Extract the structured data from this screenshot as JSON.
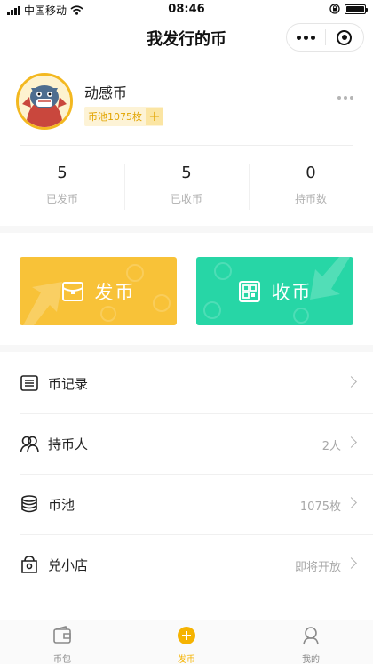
{
  "status_bar": {
    "carrier": "中国移动",
    "time": "08:46",
    "battery_level": 1.0
  },
  "nav": {
    "title": "我发行的币"
  },
  "profile": {
    "coin_name": "动感币",
    "pool_badge": "币池1075枚",
    "add_symbol": "+"
  },
  "stats": [
    {
      "value": "5",
      "label": "已发币"
    },
    {
      "value": "5",
      "label": "已收币"
    },
    {
      "value": "0",
      "label": "持币数"
    }
  ],
  "actions": {
    "send": {
      "label": "发币",
      "color": "#f8c238"
    },
    "receive": {
      "label": "收币",
      "color": "#27d6a6"
    }
  },
  "menu": [
    {
      "icon": "list-icon",
      "label": "币记录",
      "value": ""
    },
    {
      "icon": "people-icon",
      "label": "持币人",
      "value": "2人"
    },
    {
      "icon": "coin-stack-icon",
      "label": "币池",
      "value": "1075枚"
    },
    {
      "icon": "shop-icon",
      "label": "兑小店",
      "value": "即将开放"
    }
  ],
  "tabbar": [
    {
      "icon": "wallet-icon",
      "label": "币包",
      "active": false
    },
    {
      "icon": "plus-circle-icon",
      "label": "发币",
      "active": true
    },
    {
      "icon": "user-icon",
      "label": "我的",
      "active": false
    }
  ],
  "colors": {
    "accent": "#f5b301",
    "send_button": "#f8c238",
    "receive_button": "#27d6a6"
  }
}
